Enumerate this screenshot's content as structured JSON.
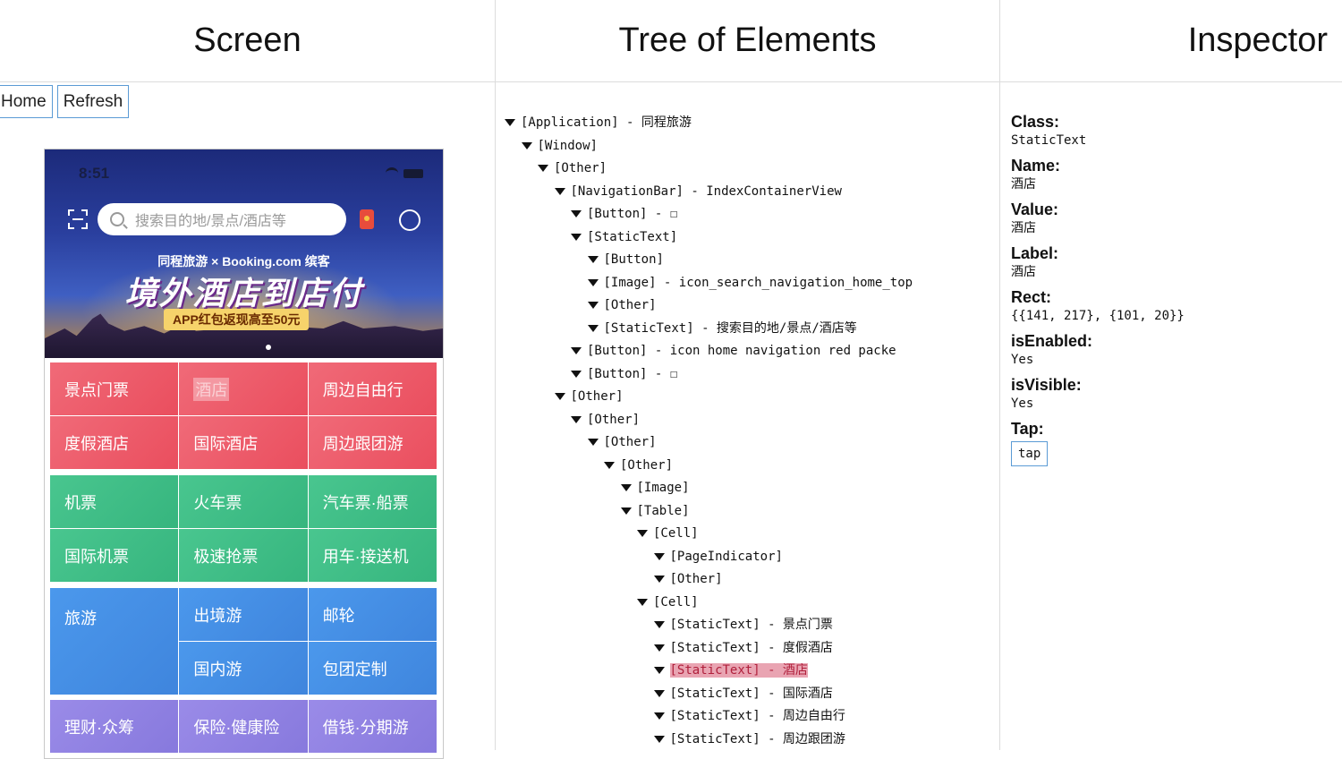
{
  "panels": {
    "screen": "Screen",
    "tree": "Tree of Elements",
    "inspector": "Inspector"
  },
  "toolbar": {
    "home": "Home",
    "refresh": "Refresh"
  },
  "phone": {
    "status_time": "8:51",
    "search_placeholder": "搜索目的地/景点/酒店等",
    "banner": {
      "brand_line": "同程旅游 × Booking.com 缤客",
      "headline": "境外酒店到店付",
      "promo": "APP红包返现高至50元"
    },
    "grid1": [
      "景点门票",
      "酒店",
      "周边自由行",
      "度假酒店",
      "国际酒店",
      "周边跟团游"
    ],
    "grid2": [
      "机票",
      "火车票",
      "汽车票·船票",
      "国际机票",
      "极速抢票",
      "用车·接送机"
    ],
    "grid3": [
      "旅游",
      "出境游",
      "邮轮",
      "国内游",
      "包团定制"
    ],
    "grid4": [
      "理财·众筹",
      "保险·健康险",
      "借钱·分期游"
    ]
  },
  "tree": [
    {
      "indent": 0,
      "text": "[Application] - 同程旅游"
    },
    {
      "indent": 1,
      "text": "[Window]"
    },
    {
      "indent": 2,
      "text": "[Other]"
    },
    {
      "indent": 3,
      "text": "[NavigationBar] - IndexContainerView"
    },
    {
      "indent": 4,
      "text": "[Button] - ☐"
    },
    {
      "indent": 4,
      "text": "[StaticText]"
    },
    {
      "indent": 5,
      "text": "[Button]"
    },
    {
      "indent": 5,
      "text": "[Image] - icon_search_navigation_home_top"
    },
    {
      "indent": 5,
      "text": "[Other]"
    },
    {
      "indent": 5,
      "text": "[StaticText] - 搜索目的地/景点/酒店等"
    },
    {
      "indent": 4,
      "text": "[Button] - icon home navigation red packe"
    },
    {
      "indent": 4,
      "text": "[Button] - ☐"
    },
    {
      "indent": 3,
      "text": "[Other]"
    },
    {
      "indent": 4,
      "text": "[Other]"
    },
    {
      "indent": 5,
      "text": "[Other]"
    },
    {
      "indent": 6,
      "text": "[Other]"
    },
    {
      "indent": 7,
      "text": "[Image]"
    },
    {
      "indent": 7,
      "text": "[Table]"
    },
    {
      "indent": 8,
      "text": "[Cell]"
    },
    {
      "indent": 9,
      "text": "[PageIndicator]"
    },
    {
      "indent": 9,
      "text": "[Other]"
    },
    {
      "indent": 8,
      "text": "[Cell]"
    },
    {
      "indent": 9,
      "text": "[StaticText] - 景点门票"
    },
    {
      "indent": 9,
      "text": "[StaticText] - 度假酒店"
    },
    {
      "indent": 9,
      "text": "[StaticText] - 酒店",
      "selected": true
    },
    {
      "indent": 9,
      "text": "[StaticText] - 国际酒店"
    },
    {
      "indent": 9,
      "text": "[StaticText] - 周边自由行"
    },
    {
      "indent": 9,
      "text": "[StaticText] - 周边跟团游"
    }
  ],
  "inspector": {
    "class_label": "Class:",
    "class_value": "StaticText",
    "name_label": "Name:",
    "name_value": "酒店",
    "value_label": "Value:",
    "value_value": "酒店",
    "label_label": "Label:",
    "label_value": "酒店",
    "rect_label": "Rect:",
    "rect_value": "{{141, 217}, {101, 20}}",
    "enabled_label": "isEnabled:",
    "enabled_value": "Yes",
    "visible_label": "isVisible:",
    "visible_value": "Yes",
    "tap_label": "Tap:",
    "tap_button": "tap"
  }
}
